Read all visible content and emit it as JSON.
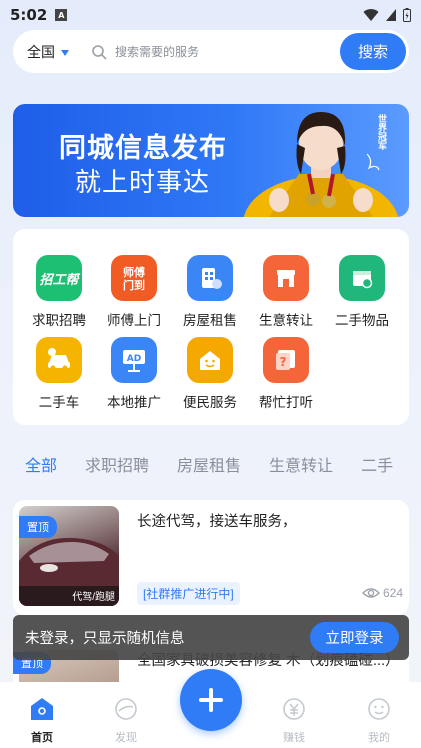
{
  "status_bar": {
    "time": "5:02",
    "sim_badge": "A"
  },
  "search": {
    "region": "全国",
    "placeholder": "搜索需要的服务",
    "button": "搜索"
  },
  "banner": {
    "line1": "同城信息发布",
    "line2": "就上时事达",
    "side_text": "世界冠军"
  },
  "categories": [
    {
      "label": "求职招聘",
      "icon": "job-recruit-icon",
      "badge": "招工帮",
      "color": "#1dbf73"
    },
    {
      "label": "师傅上门",
      "icon": "master-visit-icon",
      "badge": "师傅门到",
      "color": "#f15b24"
    },
    {
      "label": "房屋租售",
      "icon": "building-icon",
      "color": "#3a86f7"
    },
    {
      "label": "生意转让",
      "icon": "shop-icon",
      "color": "#f5653a"
    },
    {
      "label": "二手物品",
      "icon": "secondhand-goods-icon",
      "color": "#22b77a"
    },
    {
      "label": "二手车",
      "icon": "car-icon",
      "color": "#f5b400"
    },
    {
      "label": "本地推广",
      "icon": "ad-board-icon",
      "badge": "AD",
      "color": "#3a86f7"
    },
    {
      "label": "便民服务",
      "icon": "house-smile-icon",
      "color": "#f5a800"
    },
    {
      "label": "帮忙打听",
      "icon": "question-icon",
      "color": "#f5653a"
    }
  ],
  "tabs": [
    "全部",
    "求职招聘",
    "房屋租售",
    "生意转让",
    "二手"
  ],
  "posts": [
    {
      "pin": "置顶",
      "thumb_caption": "代驾/跑腿",
      "title": "长途代驾，接送车服务，",
      "tag": "[社群推广进行中]",
      "views": "624"
    },
    {
      "pin": "置顶",
      "title": "全国家具破损美容修复 木（划痕磕碰...）"
    }
  ],
  "toast": {
    "message": "未登录，只显示随机信息",
    "button": "立即登录"
  },
  "nav": [
    {
      "label": "首页",
      "icon": "home-icon"
    },
    {
      "label": "发现",
      "icon": "discover-icon"
    },
    {
      "label": "赚钱",
      "icon": "earn-icon"
    },
    {
      "label": "我的",
      "icon": "profile-icon"
    }
  ],
  "colors": {
    "accent": "#2f7cf6"
  }
}
